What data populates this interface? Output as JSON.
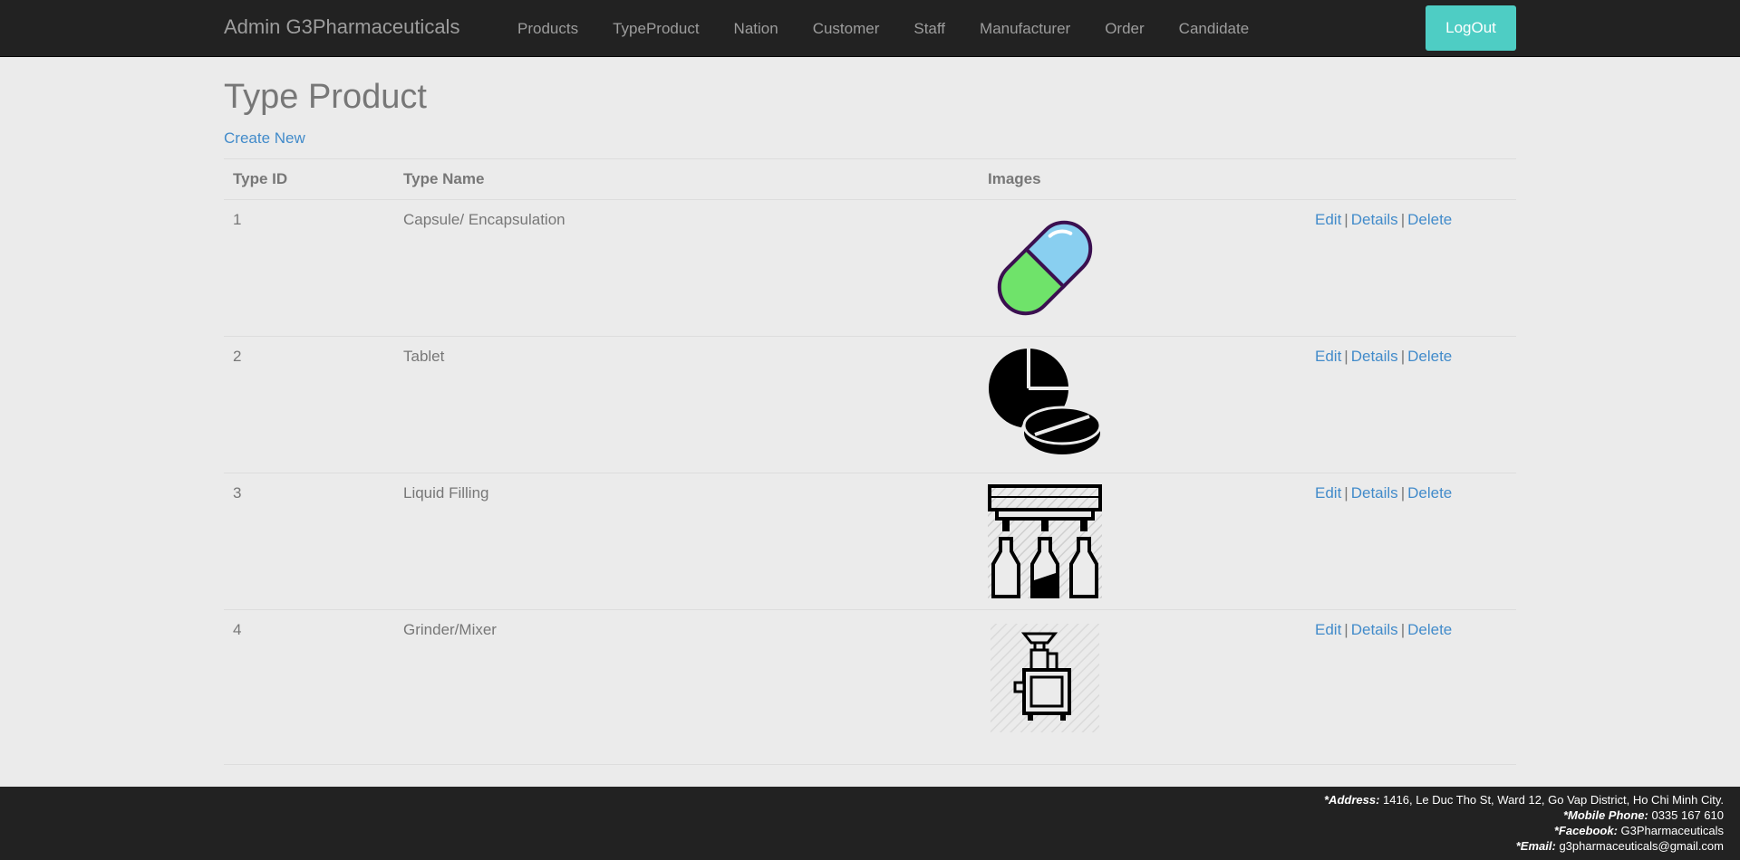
{
  "nav": {
    "brand": "Admin G3Pharmaceuticals",
    "links": [
      "Products",
      "TypeProduct",
      "Nation",
      "Customer",
      "Staff",
      "Manufacturer",
      "Order",
      "Candidate"
    ],
    "logout": "LogOut"
  },
  "main": {
    "title": "Type Product",
    "create_new": "Create New",
    "headers": {
      "id": "Type ID",
      "name": "Type Name",
      "images": "Images"
    },
    "rows": [
      {
        "id": "1",
        "name": "Capsule/ Encapsulation",
        "icon": "capsule-icon"
      },
      {
        "id": "2",
        "name": "Tablet",
        "icon": "tablet-icon"
      },
      {
        "id": "3",
        "name": "Liquid Filling",
        "icon": "liquid-filling-icon"
      },
      {
        "id": "4",
        "name": "Grinder/Mixer",
        "icon": "grinder-mixer-icon"
      }
    ],
    "actions": {
      "edit": "Edit",
      "details": "Details",
      "delete": "Delete",
      "separator": "|"
    }
  },
  "footer": {
    "address_label": "*Address:",
    "address": "1416, Le Duc Tho St, Ward 12, Go Vap District, Ho Chi Minh City.",
    "phone_label": "*Mobile Phone:",
    "phone": "0335 167 610",
    "facebook_label": "*Facebook:",
    "facebook": "G3Pharmaceuticals",
    "email_label": "*Email:",
    "email": "g3pharmaceuticals@gmail.com"
  },
  "colors": {
    "navbar": "#222222",
    "logout": "#4ecdc4",
    "link": "#428bca",
    "background": "#ebebeb"
  }
}
